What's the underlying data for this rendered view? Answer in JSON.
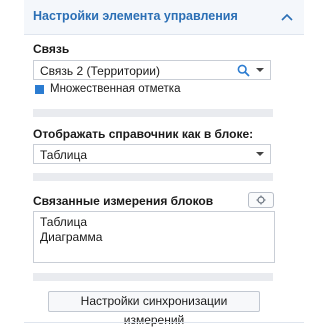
{
  "panel": {
    "title": "Настройки элемента управления"
  },
  "link": {
    "label": "Связь",
    "value": "Связь 2 (Территории)",
    "multi_select_label": "Множественная отметка",
    "multi_select_checked": true
  },
  "display": {
    "label": "Отображать справочник как в блоке:",
    "value": "Таблица"
  },
  "linked_dimensions": {
    "label": "Связанные измерения блоков",
    "items": [
      "Таблица",
      "Диаграмма"
    ]
  },
  "sync_button_label": "Настройки синхронизации измерений",
  "colors": {
    "accent": "#2b6fb5",
    "checkbox": "#2b7cd1"
  },
  "icons": [
    "chevron-up-icon",
    "search-icon",
    "dropdown-arrow-icon",
    "gear-icon"
  ]
}
